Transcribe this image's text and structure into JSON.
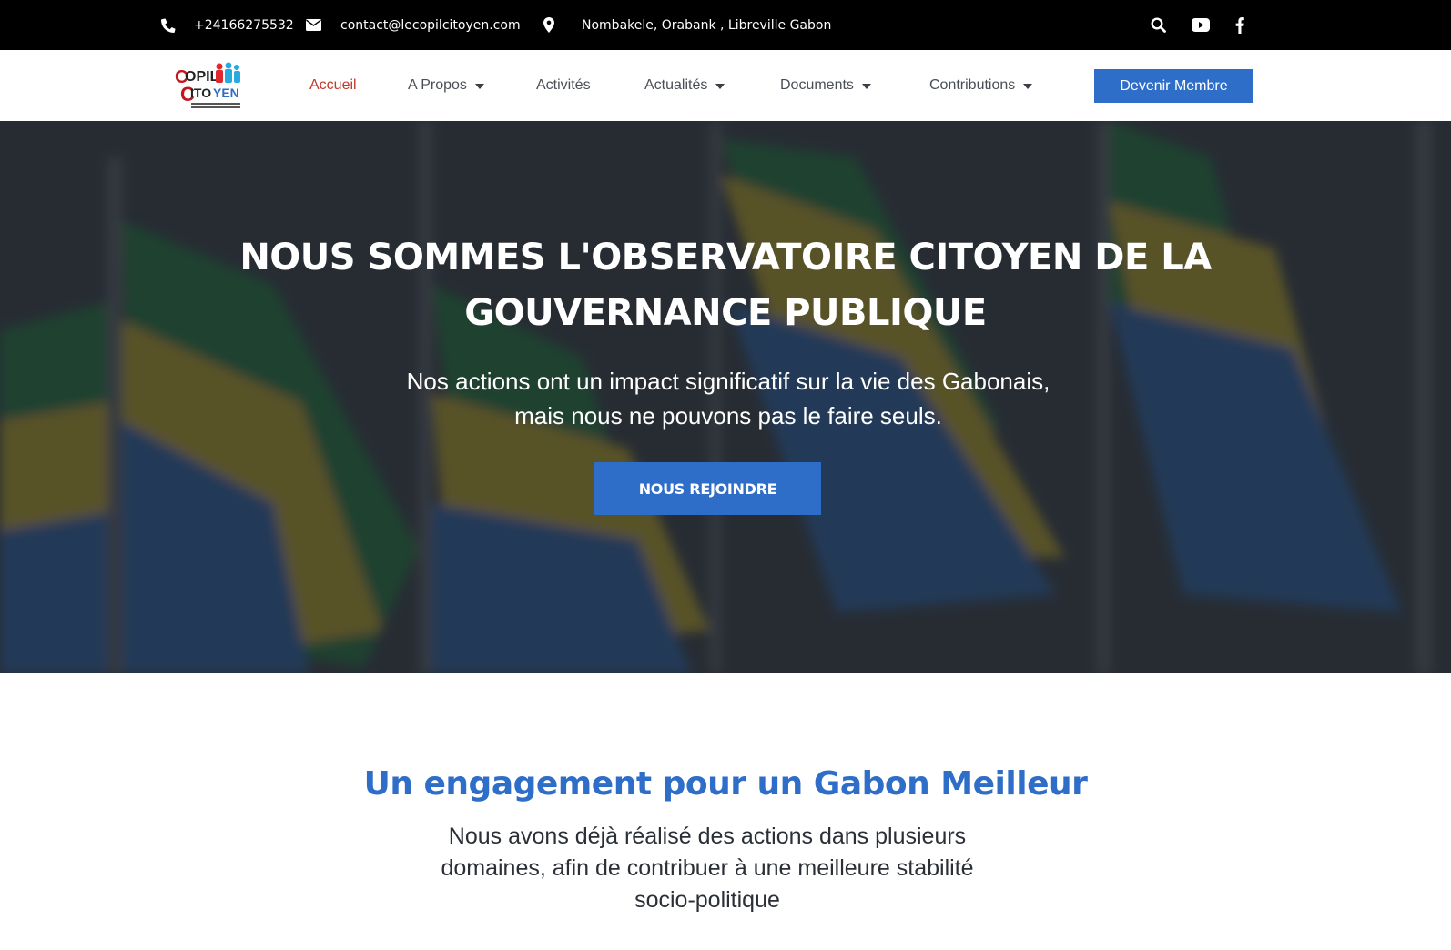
{
  "topbar": {
    "phone": "+24166275532",
    "email": "contact@lecopilcitoyen.com",
    "address": "Nombakele, Orabank , Libreville Gabon",
    "icons": [
      "phone-icon",
      "envelope-icon",
      "map-pin-icon",
      "search-icon",
      "youtube-icon",
      "facebook-icon"
    ]
  },
  "header": {
    "logo_text": [
      "COPIL",
      "CITOYEN"
    ],
    "nav": [
      {
        "label": "Accueil",
        "active": true,
        "dropdown": false
      },
      {
        "label": "A Propos",
        "active": false,
        "dropdown": true
      },
      {
        "label": "Activités",
        "active": false,
        "dropdown": false
      },
      {
        "label": "Actualités",
        "active": false,
        "dropdown": true
      },
      {
        "label": "Documents",
        "active": false,
        "dropdown": true
      },
      {
        "label": "Contributions",
        "active": false,
        "dropdown": true
      }
    ],
    "cta_label": "Devenir Membre"
  },
  "hero": {
    "title_line1": "NOUS SOMMES L'OBSERVATOIRE CITOYEN DE LA",
    "title_line2": "GOUVERNANCE PUBLIQUE",
    "subtitle_line1": "Nos actions ont un impact significatif sur la vie des Gabonais,",
    "subtitle_line2": "mais nous ne pouvons pas le faire seuls.",
    "button_label": "NOUS REJOINDRE"
  },
  "section": {
    "title": "Un engagement pour un Gabon Meilleur",
    "text_line1": "Nous avons déjà réalisé  des actions dans plusieurs",
    "text_line2": "domaines, afin de contribuer à une meilleure stabilité",
    "text_line3": "socio-politique"
  },
  "colors": {
    "accent": "#2f6ec8",
    "active_nav": "#c0392b",
    "topbar_bg": "#000000",
    "hero_overlay": "#20252d"
  }
}
